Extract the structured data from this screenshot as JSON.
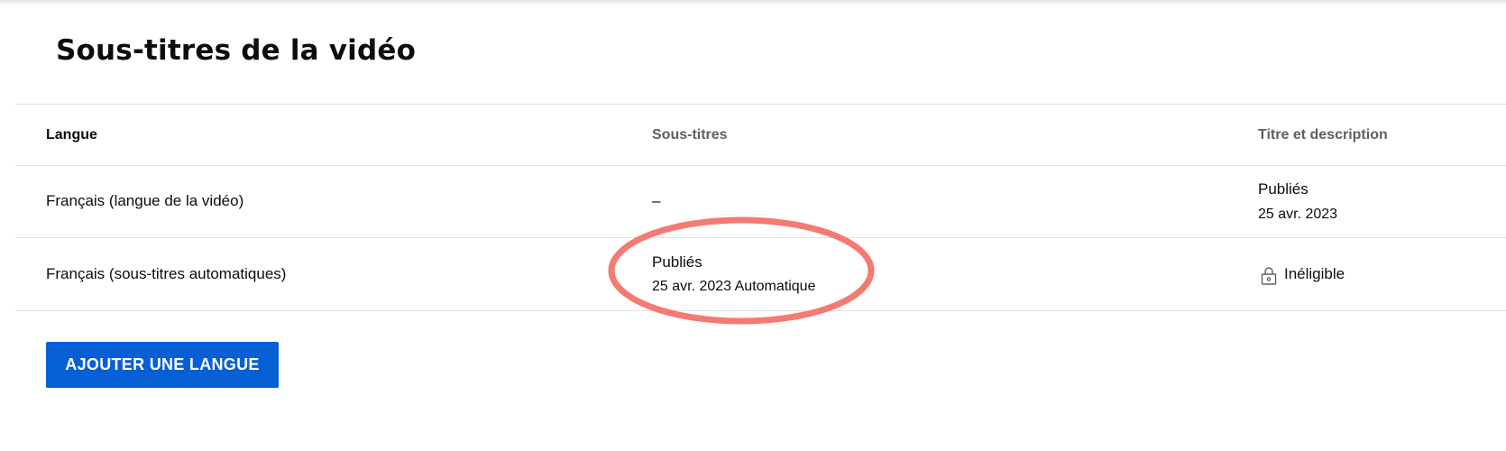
{
  "page": {
    "title": "Sous-titres de la vidéo"
  },
  "table": {
    "headers": {
      "language": "Langue",
      "subtitles": "Sous-titres",
      "title_description": "Titre et description"
    },
    "rows": [
      {
        "language": "Français (langue de la vidéo)",
        "subtitles_status": "–",
        "title_description_status": "Publiés",
        "title_description_date": "25 avr. 2023"
      },
      {
        "language": "Français (sous-titres automatiques)",
        "subtitles_status": "Publiés",
        "subtitles_date": "25 avr. 2023 Automatique",
        "title_description_status": "Inéligible",
        "title_description_icon": "lock-icon"
      }
    ]
  },
  "actions": {
    "add_language_label": "AJOUTER UNE LANGUE",
    "accent_color": "#065fd4"
  },
  "annotation": {
    "highlight_color": "#f47a72"
  }
}
